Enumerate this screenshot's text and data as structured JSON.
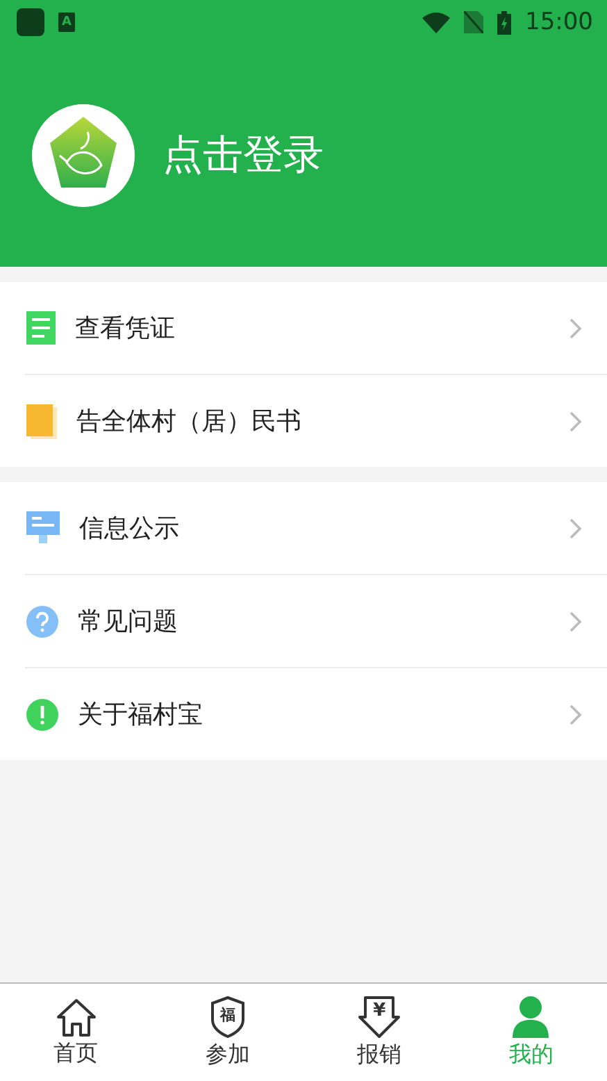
{
  "status_bar": {
    "badge": "A",
    "time": "15:00"
  },
  "profile": {
    "login_text": "点击登录"
  },
  "menu_groups": [
    {
      "items": [
        {
          "kind": "document",
          "label": "查看凭证"
        },
        {
          "kind": "book",
          "label": "告全体村（居）民书"
        }
      ]
    },
    {
      "items": [
        {
          "kind": "monitor",
          "label": "信息公示"
        },
        {
          "kind": "question",
          "label": "常见问题"
        },
        {
          "kind": "info",
          "label": "关于福村宝"
        }
      ]
    }
  ],
  "tabs": [
    {
      "kind": "home",
      "label": "首页",
      "selected": false
    },
    {
      "kind": "shield",
      "glyph": "福",
      "label": "参加",
      "selected": false
    },
    {
      "kind": "download",
      "glyph": "¥",
      "label": "报销",
      "selected": false
    },
    {
      "kind": "person",
      "label": "我的",
      "selected": true
    }
  ]
}
